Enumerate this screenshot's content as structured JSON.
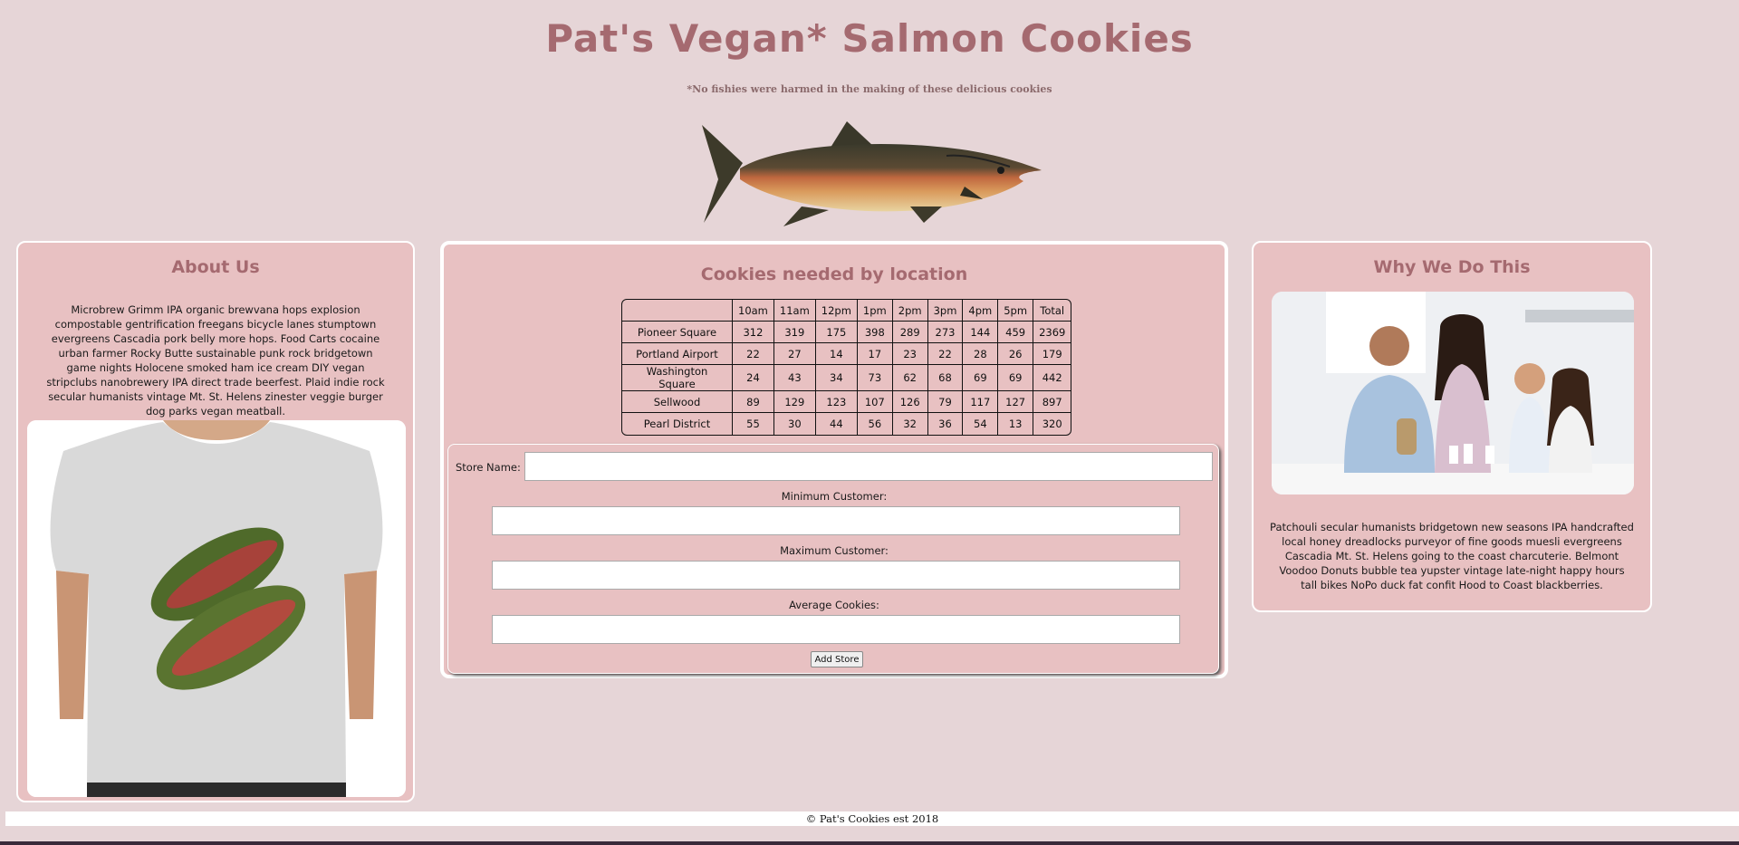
{
  "header": {
    "title": "Pat's Vegan* Salmon Cookies",
    "subtitle": "*No fishies were harmed in the making of these delicious cookies"
  },
  "about": {
    "heading": "About Us",
    "text": "Microbrew Grimm IPA organic brewvana hops explosion compostable gentrification freegans bicycle lanes stumptown evergreens Cascadia pork belly more hops. Food Carts cocaine urban farmer Rocky Butte sustainable punk rock bridgetown game nights Holocene smoked ham ice cream DIY vegan stripclubs nanobrewery IPA direct trade beerfest. Plaid indie rock secular humanists vintage Mt. St. Helens zinester veggie burger dog parks vegan meatball."
  },
  "sales": {
    "heading": "Cookies needed by location",
    "columns": [
      "",
      "10am",
      "11am",
      "12pm",
      "1pm",
      "2pm",
      "3pm",
      "4pm",
      "5pm",
      "Total"
    ],
    "rows": [
      [
        "Pioneer Square",
        "312",
        "319",
        "175",
        "398",
        "289",
        "273",
        "144",
        "459",
        "2369"
      ],
      [
        "Portland Airport",
        "22",
        "27",
        "14",
        "17",
        "23",
        "22",
        "28",
        "26",
        "179"
      ],
      [
        "Washington Square",
        "24",
        "43",
        "34",
        "73",
        "62",
        "68",
        "69",
        "69",
        "442"
      ],
      [
        "Sellwood",
        "89",
        "129",
        "123",
        "107",
        "126",
        "79",
        "117",
        "127",
        "897"
      ],
      [
        "Pearl District",
        "55",
        "30",
        "44",
        "56",
        "32",
        "36",
        "54",
        "13",
        "320"
      ]
    ]
  },
  "form": {
    "store_name_label": "Store Name:",
    "min_label": "Minimum Customer:",
    "max_label": "Maximum Customer:",
    "avg_label": "Average Cookies:",
    "store_name_value": "",
    "min_value": "",
    "max_value": "",
    "avg_value": "",
    "submit_label": "Add Store"
  },
  "why": {
    "heading": "Why We Do This",
    "text": "Patchouli secular humanists bridgetown new seasons IPA handcrafted local honey dreadlocks purveyor of fine goods muesli evergreens Cascadia Mt. St. Helens going to the coast charcuterie. Belmont Voodoo Donuts bubble tea yupster vintage late-night happy hours tall bikes NoPo duck fat confit Hood to Coast blackberries."
  },
  "footer": {
    "text": "© Pat's Cookies est 2018"
  },
  "colors": {
    "background": "#e6d5d7",
    "panel": "#e8c1c2",
    "heading": "#a56a70"
  },
  "icons": {
    "hero": "salmon-illustration",
    "shirt": "salmon-tshirt-photo",
    "family": "family-kitchen-photo"
  }
}
